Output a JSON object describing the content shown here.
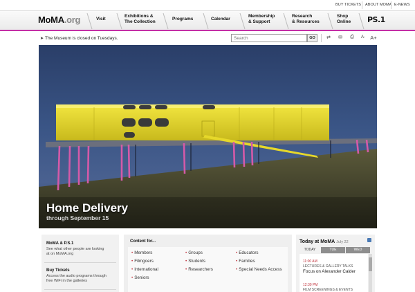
{
  "util": {
    "buy_tickets": "BUY TICKETS",
    "about": "ABOUT MOMA",
    "enews": "E-NEWS"
  },
  "brand": {
    "logo_main": "MoMA",
    "logo_dot": ".org"
  },
  "nav": {
    "visit": "Visit",
    "exhibitions_1": "Exhibitions &",
    "exhibitions_2": "The Collection",
    "programs": "Programs",
    "calendar": "Calendar",
    "membership_1": "Membership",
    "membership_2": "& Support",
    "research_1": "Research",
    "research_2": "& Resources",
    "shop_1": "Shop",
    "shop_2": "Online",
    "ps1": "PS.1"
  },
  "notice": "The Museum is closed on Tuesdays.",
  "search": {
    "placeholder": "Search",
    "go": "GO"
  },
  "tools": {
    "font_smaller": "A-",
    "font_larger": "A+"
  },
  "hero": {
    "title": "Home Delivery",
    "subtitle": "through September 15"
  },
  "left_panel": {
    "item1_title": "MoMA & P.S.1",
    "item1_line1": "See what other people are looking",
    "item1_line2": "at on MoMA.org",
    "item2_title": "Buy Tickets",
    "item2_line1": "Access the audio programs through",
    "item2_line2": "free WiFi in the galleries"
  },
  "content_for": {
    "heading": "Content for...",
    "col1": [
      "Members",
      "Filmgoers",
      "International",
      "Seniors"
    ],
    "col2": [
      "Groups",
      "Students",
      "Researchers"
    ],
    "col3": [
      "Educators",
      "Families",
      "Special Needs Access"
    ]
  },
  "today": {
    "heading": "Today at MoMA",
    "date": "July 22",
    "tabs": [
      "TODAY",
      "TUE",
      "WED"
    ],
    "events": [
      {
        "time": "11:00 AM",
        "category": "LECTURES & GALLERY TALKS",
        "title": "Focus on Alexander Calder"
      },
      {
        "time": "12:30 PM",
        "category": "FILM SCREENINGS & EVENTS"
      }
    ]
  },
  "colors": {
    "accent": "#c42fa6",
    "event_time": "#c0303a",
    "hero_yellow": "#e8dc2a"
  }
}
